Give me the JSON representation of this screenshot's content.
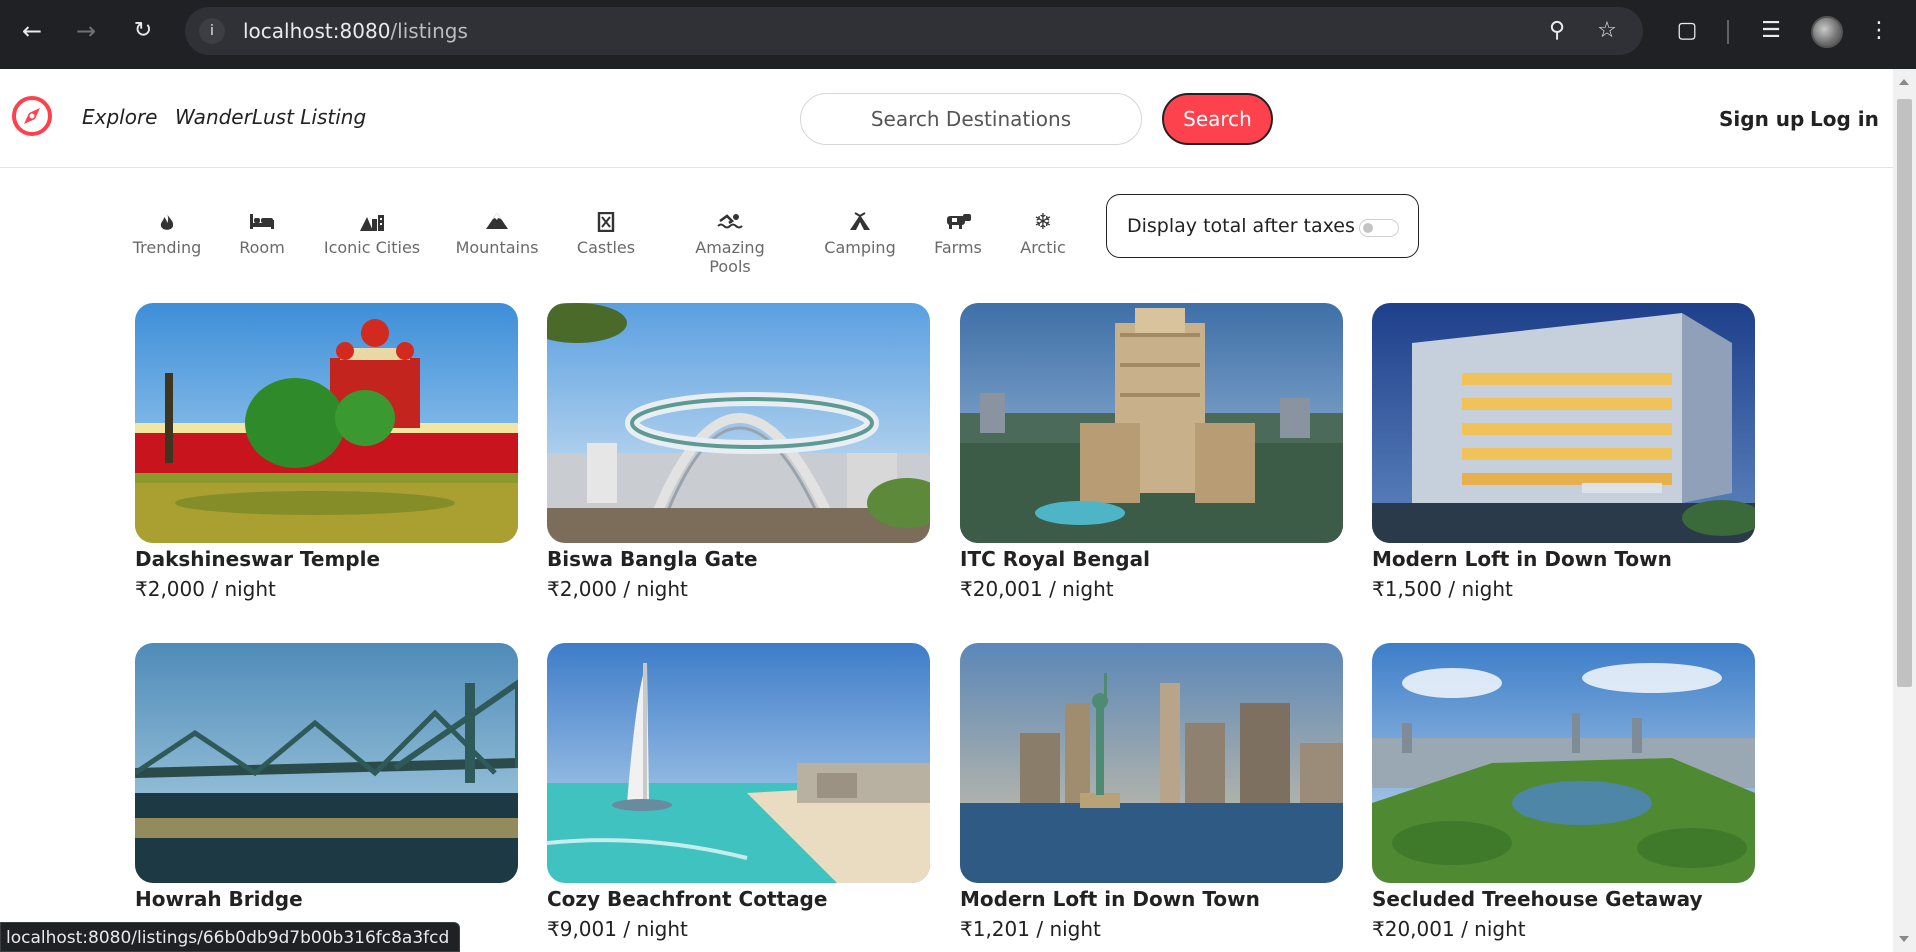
{
  "browser": {
    "url_host": "localhost:8080",
    "url_path": "/listings",
    "status_url": "localhost:8080/listings/66b0db9d7b00b316fc8a3fcd"
  },
  "header": {
    "nav": {
      "explore": "Explore",
      "wanderlust": "WanderLust Listing"
    },
    "search": {
      "placeholder": "Search Destinations",
      "button": "Search"
    },
    "auth": {
      "signup": "Sign up",
      "login": "Log in"
    }
  },
  "filters": [
    {
      "label": "Trending",
      "icon": "fire-icon"
    },
    {
      "label": "Room",
      "icon": "bed-icon"
    },
    {
      "label": "Iconic Cities",
      "icon": "mountain-city-icon"
    },
    {
      "label": "Mountains",
      "icon": "mountain-icon"
    },
    {
      "label": "Castles",
      "icon": "fort-icon"
    },
    {
      "label": "Amazing Pools",
      "icon": "swimmer-icon"
    },
    {
      "label": "Camping",
      "icon": "campground-icon"
    },
    {
      "label": "Farms",
      "icon": "cow-icon"
    },
    {
      "label": "Arctic",
      "icon": "snowflake-icon"
    }
  ],
  "tax_toggle": {
    "label": "Display total after taxes",
    "on": false
  },
  "listings": [
    {
      "title": "Dakshineswar Temple",
      "price": "₹2,000",
      "per": " / night"
    },
    {
      "title": "Biswa Bangla Gate",
      "price": "₹2,000",
      "per": " / night"
    },
    {
      "title": "ITC Royal Bengal",
      "price": "₹20,001",
      "per": " / night"
    },
    {
      "title": "Modern Loft in Down Town",
      "price": "₹1,500",
      "per": " / night"
    },
    {
      "title": "Howrah Bridge",
      "price": "",
      "per": ""
    },
    {
      "title": "Cozy Beachfront Cottage",
      "price": "₹9,001",
      "per": " / night"
    },
    {
      "title": "Modern Loft in Down Town",
      "price": "₹1,201",
      "per": " / night"
    },
    {
      "title": "Secluded Treehouse Getaway",
      "price": "₹20,001",
      "per": " / night"
    }
  ],
  "colors": {
    "brand": "#fe424d",
    "chrome_bg": "#202124"
  }
}
